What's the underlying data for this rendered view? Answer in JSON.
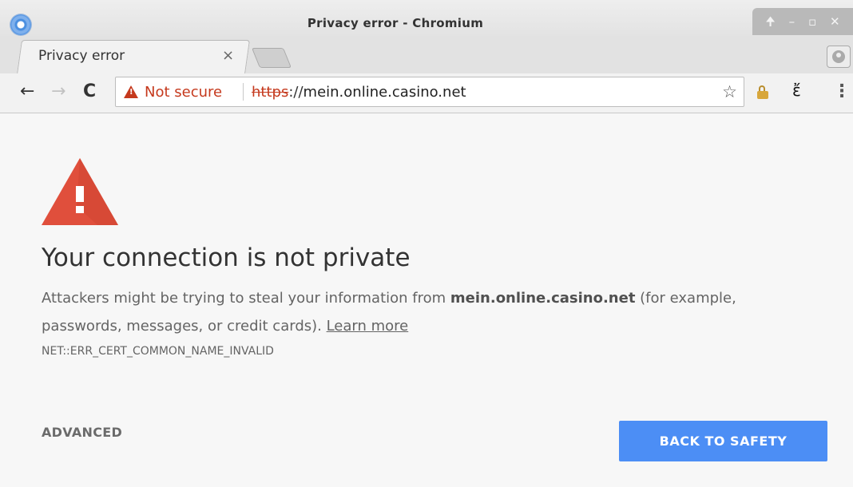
{
  "window": {
    "title": "Privacy error - Chromium",
    "controls": [
      "🠉",
      "–",
      "▫",
      "✕"
    ]
  },
  "tab": {
    "title": "Privacy error",
    "close_label": "×"
  },
  "toolbar": {
    "back_label": "←",
    "forward_label": "→",
    "reload_label": "C",
    "security_label": "Not secure",
    "url_scheme": "https",
    "url_separator": "://",
    "url_host": "mein.online.casino.net",
    "bookmark_label": "☆",
    "extension2_label": "ἔ",
    "menu_label": "⋮",
    "icons": [
      "warning-icon",
      "star-icon",
      "lock-extension-icon",
      "foot-extension-icon",
      "menu-icon",
      "profile-icon"
    ]
  },
  "content": {
    "title": "Your connection is not private",
    "message_before": "Attackers might be trying to steal your information from ",
    "message_host": "mein.online.casino.net",
    "message_after": " (for example, passwords, messages, or credit cards). ",
    "learn_more": "Learn more",
    "error_code": "NET::ERR_CERT_COMMON_NAME_INVALID",
    "advanced_label": "ADVANCED",
    "back_to_safety_label": "BACK TO SAFETY"
  },
  "colors": {
    "warning_red": "#e04f3c",
    "security_red": "#c5391d",
    "primary_button": "#4c8ef5",
    "page_background": "#f7f7f7"
  }
}
